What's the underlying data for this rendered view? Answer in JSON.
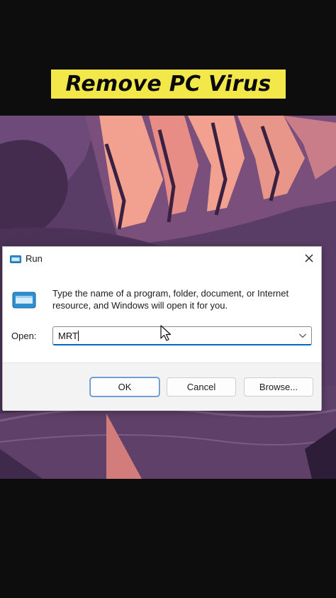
{
  "banner": {
    "title": "Remove PC Virus"
  },
  "dialog": {
    "title": "Run",
    "description": "Type the name of a program, folder, document, or Internet resource, and Windows will open it for you.",
    "open_label": "Open:",
    "input_value": "MRT",
    "buttons": {
      "ok": "OK",
      "cancel": "Cancel",
      "browse": "Browse..."
    }
  },
  "colors": {
    "banner_bg": "#f3e84a",
    "wallpaper_primary": "#5c3f68",
    "wallpaper_accent": "#f2a08f",
    "focus_accent": "#0067c0"
  },
  "icons": [
    "run-app-icon",
    "close-icon",
    "chevron-down-icon",
    "mouse-cursor-icon"
  ]
}
